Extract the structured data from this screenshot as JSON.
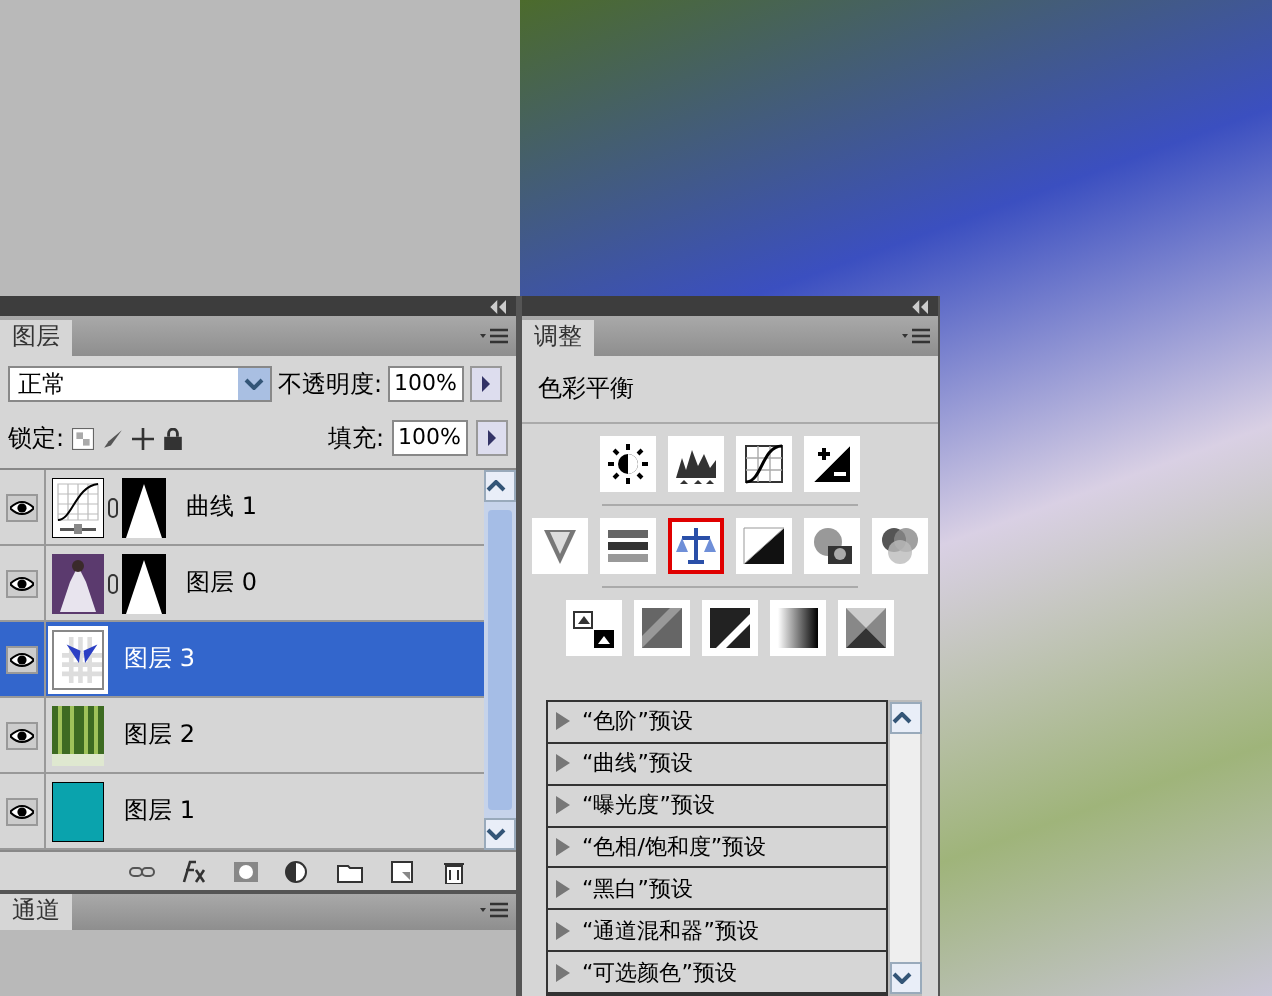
{
  "layers_panel": {
    "tab": "图层",
    "blend_mode": "正常",
    "opacity_label": "不透明度:",
    "opacity": "100%",
    "lock_label": "锁定:",
    "fill_label": "填充:",
    "fill": "100%",
    "layers": [
      {
        "name": "曲线 1",
        "kind": "curves",
        "has_mask": true,
        "visible": true,
        "selected": false
      },
      {
        "name": "图层 0",
        "kind": "photo",
        "has_mask": true,
        "visible": true,
        "selected": false
      },
      {
        "name": "图层 3",
        "kind": "wings",
        "has_mask": false,
        "visible": true,
        "selected": true
      },
      {
        "name": "图层 2",
        "kind": "forest",
        "has_mask": false,
        "visible": true,
        "selected": false
      },
      {
        "name": "图层 1",
        "kind": "fill",
        "has_mask": false,
        "visible": true,
        "selected": false
      }
    ]
  },
  "channels_panel": {
    "tab": "通道"
  },
  "adjustments_panel": {
    "tab": "调整",
    "title": "色彩平衡",
    "icon_rows": [
      [
        {
          "kind": "brightness",
          "selected": false
        },
        {
          "kind": "levels",
          "selected": false
        },
        {
          "kind": "curves",
          "selected": false
        },
        {
          "kind": "exposure",
          "selected": false
        }
      ],
      [
        {
          "kind": "vibrance",
          "selected": false
        },
        {
          "kind": "huesat",
          "selected": false
        },
        {
          "kind": "balance",
          "selected": true
        },
        {
          "kind": "bw",
          "selected": false
        },
        {
          "kind": "photofilter",
          "selected": false
        },
        {
          "kind": "mixer",
          "selected": false
        }
      ],
      [
        {
          "kind": "invert",
          "selected": false
        },
        {
          "kind": "posterize",
          "selected": false
        },
        {
          "kind": "threshold",
          "selected": false
        },
        {
          "kind": "gradient",
          "selected": false
        },
        {
          "kind": "selective",
          "selected": false
        }
      ]
    ],
    "presets": [
      "“色阶”预设",
      "“曲线”预设",
      "“曝光度”预设",
      "“色相/饱和度”预设",
      "“黑白”预设",
      "“通道混和器”预设",
      "“可选颜色”预设"
    ]
  }
}
